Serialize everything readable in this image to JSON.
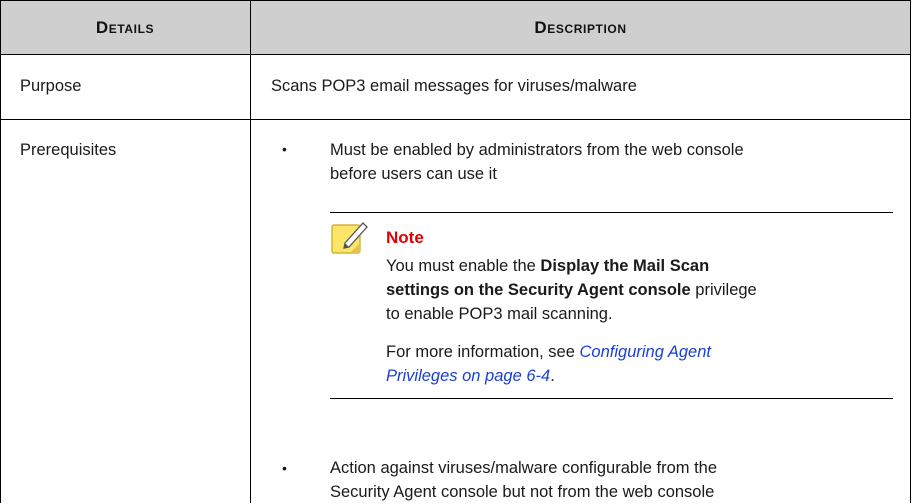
{
  "table": {
    "headers": {
      "details": "Details",
      "description": "Description"
    },
    "rows": [
      {
        "detail": "Purpose",
        "description": "Scans POP3 email messages for viruses/malware"
      },
      {
        "detail": "Prerequisites"
      }
    ]
  },
  "prerequisites": {
    "bullet1": {
      "line1": "Must be enabled by administrators from the web console",
      "line2": "before users can use it"
    },
    "note": {
      "title": "Note",
      "p1_l1_pre": "You must enable the ",
      "p1_l1_bold": "Display the Mail Scan",
      "p1_l2_bold": "settings on the Security Agent console",
      "p1_l2_post": " privilege",
      "p1_l3": "to enable POP3 mail scanning.",
      "p2_l1_pre": "For more information, see ",
      "p2_link_l1": "Configuring Agent",
      "p2_link_l2": "Privileges on page 6-4",
      "p2_post": "."
    },
    "bullet2": {
      "line1": "Action against viruses/malware configurable from the",
      "line2": "Security Agent console but not from the web console"
    },
    "bullet_char": "•"
  }
}
